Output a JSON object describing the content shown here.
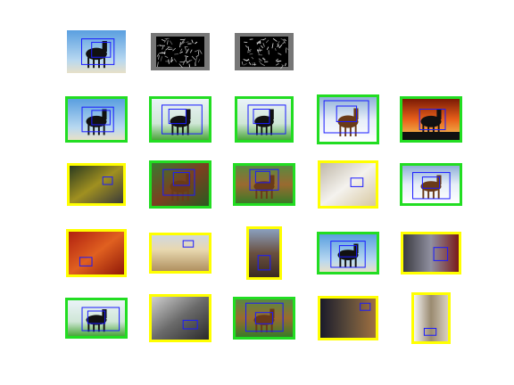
{
  "figure": {
    "description_free": true,
    "colors": {
      "positive_frame": "#22dd22",
      "ambiguous_frame": "#ffff00",
      "box": "#1a1aff",
      "hog_background": "#777777"
    },
    "query_row": [
      {
        "kind": "photo",
        "scene": "sky"
      },
      {
        "kind": "hog-template"
      },
      {
        "kind": "hog-template"
      }
    ],
    "result_rows": [
      [
        {
          "scene": "sky",
          "frame": "positive"
        },
        {
          "scene": "grass",
          "frame": "positive"
        },
        {
          "scene": "grass",
          "frame": "positive"
        },
        {
          "scene": "snow",
          "frame": "positive"
        },
        {
          "scene": "sunset",
          "frame": "positive"
        }
      ],
      [
        {
          "scene": "dark-yellow",
          "frame": "ambiguous"
        },
        {
          "scene": "brown",
          "frame": "positive"
        },
        {
          "scene": "brown-grass",
          "frame": "positive"
        },
        {
          "scene": "white-dog",
          "frame": "ambiguous"
        },
        {
          "scene": "snow",
          "frame": "positive"
        }
      ],
      [
        {
          "scene": "red",
          "frame": "ambiguous"
        },
        {
          "scene": "beach",
          "frame": "ambiguous"
        },
        {
          "scene": "portrait-dark",
          "frame": "ambiguous"
        },
        {
          "scene": "sky",
          "frame": "positive"
        },
        {
          "scene": "street",
          "frame": "ambiguous"
        }
      ],
      [
        {
          "scene": "grass",
          "frame": "positive"
        },
        {
          "scene": "gray",
          "frame": "ambiguous"
        },
        {
          "scene": "brown-grass",
          "frame": "positive"
        },
        {
          "scene": "man",
          "frame": "ambiguous"
        },
        {
          "scene": "portrait-light",
          "frame": "ambiguous"
        }
      ]
    ]
  }
}
